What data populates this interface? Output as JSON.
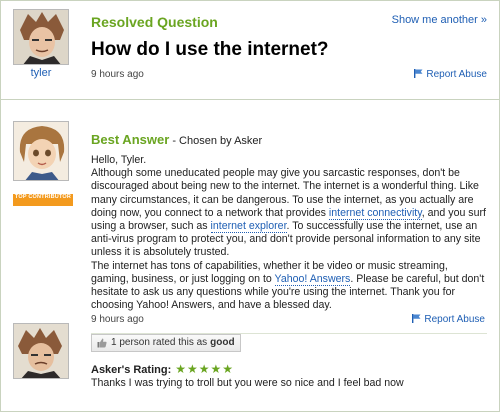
{
  "question": {
    "status": "Resolved Question",
    "show_more": "Show me another »",
    "title": "How do I use the internet?",
    "username": "tyler",
    "time": "9 hours ago",
    "report": "Report Abuse"
  },
  "answer": {
    "best_label": "Best Answer",
    "chosen_by": " - Chosen by Asker",
    "badge": "TOP CONTRIBUTOR",
    "greeting": "Hello, Tyler.",
    "p1_a": "Although some uneducated people may give you sarcastic responses, don't be discouraged about being new to the internet. The internet is a wonderful thing. Like many circumstances, it can be dangerous. To use the internet, as you actually are doing now, you connect to a network that provides ",
    "p1_link1": "internet connectivity",
    "p1_b": ", and you surf using a browser, such as ",
    "p1_link2": "internet explorer",
    "p1_c": ". To successfully use the internet, use an anti-virus program to protect you, and don't provide personal information to any site unless it is absolutely trusted.",
    "p2_a": "The internet has tons of capabilities, whether it be video or music streaming, gaming, business, or just logging on to ",
    "p2_link": "Yahoo! Answers",
    "p2_b": ". Please be careful, but don't hesitate to ask us any questions while you're using the internet. Thank you for choosing Yahoo! Answers, and have a blessed day.",
    "time": "9 hours ago",
    "report": "Report Abuse"
  },
  "rating": {
    "rated_text": "1 person rated this as",
    "rated_value": "good",
    "asker_rating_label": "Asker's Rating:",
    "stars": "★★★★★",
    "star_count": 5,
    "comment": "Thanks I was trying to troll but you were so nice and I feel bad now"
  },
  "colors": {
    "accent_green": "#6aa521",
    "link_blue": "#1f5fb4",
    "badge_orange": "#f39a1e"
  }
}
